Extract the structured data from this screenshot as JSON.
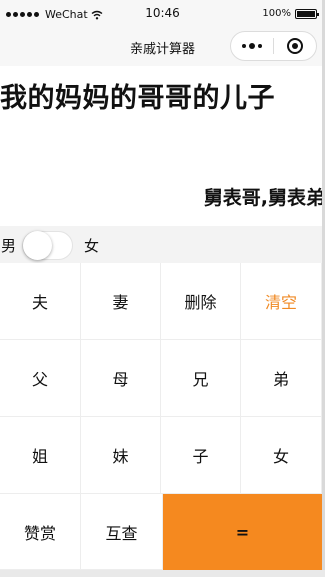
{
  "status_bar": {
    "carrier": "WeChat",
    "time": "10:46",
    "battery": "100%"
  },
  "nav": {
    "title": "亲戚计算器"
  },
  "display": {
    "input": "我的妈妈的哥哥的儿子",
    "result": "舅表哥,舅表弟"
  },
  "gender": {
    "male": "男",
    "female": "女",
    "toggle_on": false
  },
  "keys": [
    [
      {
        "label": "夫"
      },
      {
        "label": "妻"
      },
      {
        "label": "删除"
      },
      {
        "label": "清空"
      }
    ],
    [
      {
        "label": "父"
      },
      {
        "label": "母"
      },
      {
        "label": "兄"
      },
      {
        "label": "弟"
      }
    ],
    [
      {
        "label": "姐"
      },
      {
        "label": "妹"
      },
      {
        "label": "子"
      },
      {
        "label": "女"
      }
    ],
    [
      {
        "label": "赞赏"
      },
      {
        "label": "互查"
      },
      {
        "label": "="
      }
    ]
  ],
  "colors": {
    "accent": "#f5891f",
    "clear_text": "#f08a24"
  }
}
